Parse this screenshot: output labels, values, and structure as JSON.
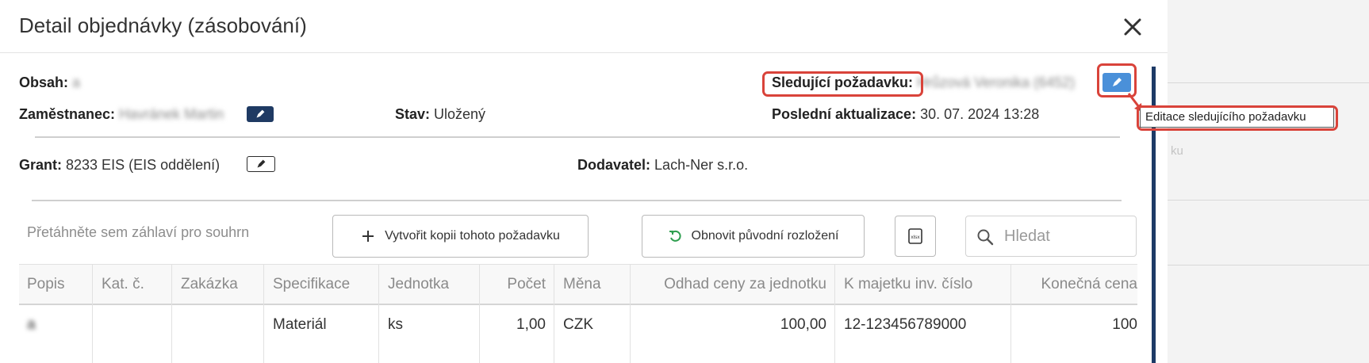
{
  "dialog": {
    "title": "Detail objednávky (zásobování)"
  },
  "icons": {
    "close": "close-icon",
    "edit": "pencil-icon",
    "plus": "plus-icon",
    "reset": "undo-icon",
    "export": "xlsx-export-icon",
    "search": "search-icon"
  },
  "info": {
    "obsah_label": "Obsah:",
    "obsah_value": "a",
    "zamestnanec_label": "Zaměstnanec:",
    "zamestnanec_value": "Havránek Martin",
    "stav_label": "Stav:",
    "stav_value": "Uložený",
    "sledujici_label": "Sledující požadavku:",
    "sledujici_value": "Hrůzová Veronika (6452)",
    "posledni_label": "Poslední aktualizace:",
    "posledni_value": "30. 07. 2024 13:28",
    "grant_label": "Grant:",
    "grant_value": "8233 EIS (EIS oddělení)",
    "dodavatel_label": "Dodavatel:",
    "dodavatel_value": "Lach-Ner s.r.o."
  },
  "tooltip": "Editace sledujícího požadavku",
  "toolbar": {
    "group_hint": "Přetáhněte sem záhlaví pro souhrn",
    "copy_label": "Vytvořit kopii tohoto požadavku",
    "reset_label": "Obnovit původní rozložení",
    "search_placeholder": "Hledat"
  },
  "table": {
    "columns": [
      "Popis",
      "Kat. č.",
      "Zakázka",
      "Specifikace",
      "Jednotka",
      "Počet",
      "Měna",
      "Odhad ceny za jednotku",
      "K majetku inv. číslo",
      "Konečná cena"
    ],
    "rows": [
      [
        "a",
        "",
        "",
        "Materiál",
        "ks",
        "1,00",
        "CZK",
        "100,00",
        "12-123456789000",
        "100"
      ]
    ]
  },
  "background": {
    "hint": "ku"
  },
  "colors": {
    "highlight": "#d9433a",
    "navy": "#1f3a63",
    "edit_blue": "#4a90d9"
  }
}
